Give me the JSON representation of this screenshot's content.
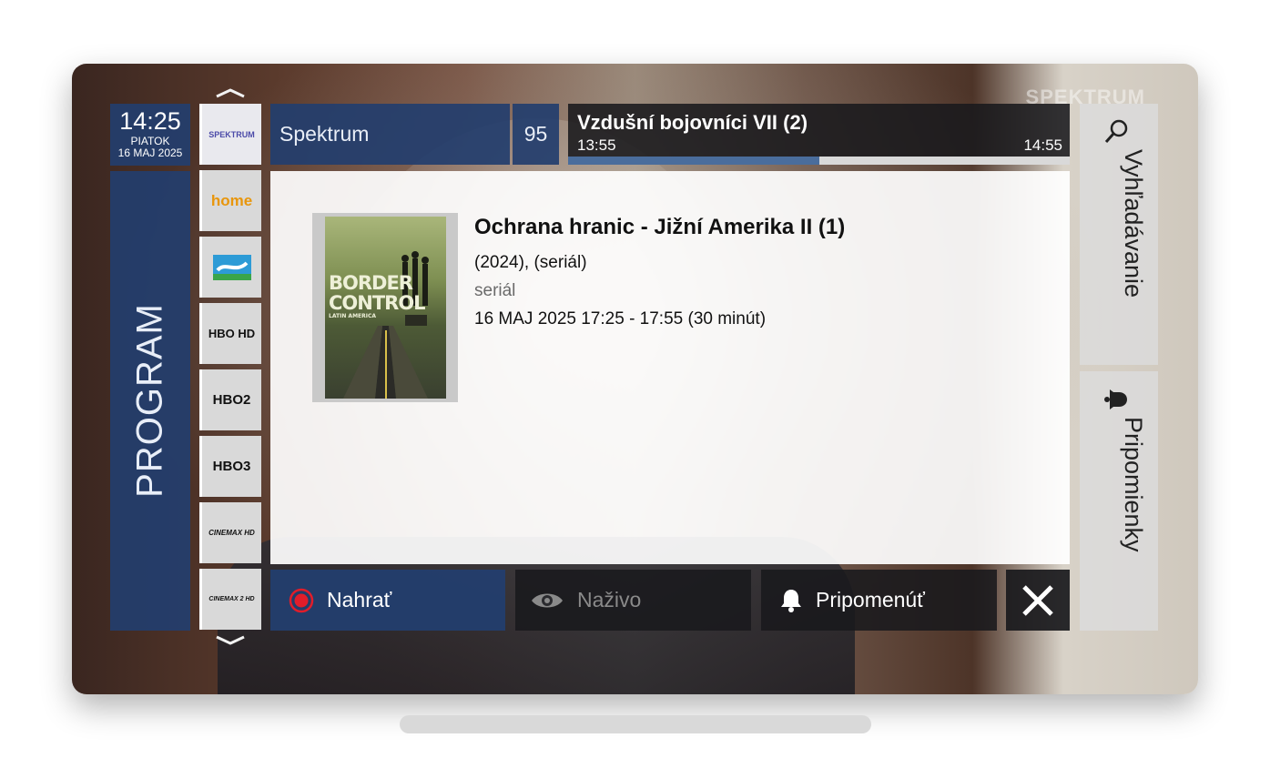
{
  "clock": {
    "time": "14:25",
    "day": "PIATOK",
    "date": "16 MAJ 2025"
  },
  "sidebar": {
    "label": "PROGRAM"
  },
  "watermark": "SPEKTRUM",
  "channels": [
    {
      "name": "SPEKTRUM"
    },
    {
      "name": "home"
    },
    {
      "name": "Spektrum Home logo"
    },
    {
      "name": "HBO HD"
    },
    {
      "name": "HBO2"
    },
    {
      "name": "HBO3"
    },
    {
      "name": "CINEMAX HD"
    },
    {
      "name": "CINEMAX 2 HD"
    }
  ],
  "header": {
    "channel_name": "Spektrum",
    "channel_number": "95",
    "now_title": "Vzdušní bojovníci VII (2)",
    "now_start": "13:55",
    "now_end": "14:55",
    "progress": 0.5
  },
  "detail": {
    "title": "Ochrana hranic - Jižní Amerika II (1)",
    "year_line": "(2024), (seriál)",
    "genre": "seriál",
    "when": "16 MAJ 2025 17:25 - 17:55 (30 minút)",
    "poster_text_1": "BORDER",
    "poster_text_2": "CONTROL",
    "poster_text_3": "LATIN AMERICA"
  },
  "actions": {
    "record": "Nahrať",
    "live": "Naživo",
    "remind": "Pripomenúť"
  },
  "side": {
    "search": "Vyhľadávanie",
    "reminders": "Pripomienky"
  },
  "colors": {
    "accent_blue": "#233e6e",
    "record_red": "#e11d2a",
    "progress_fill": "#4a6d9c"
  }
}
